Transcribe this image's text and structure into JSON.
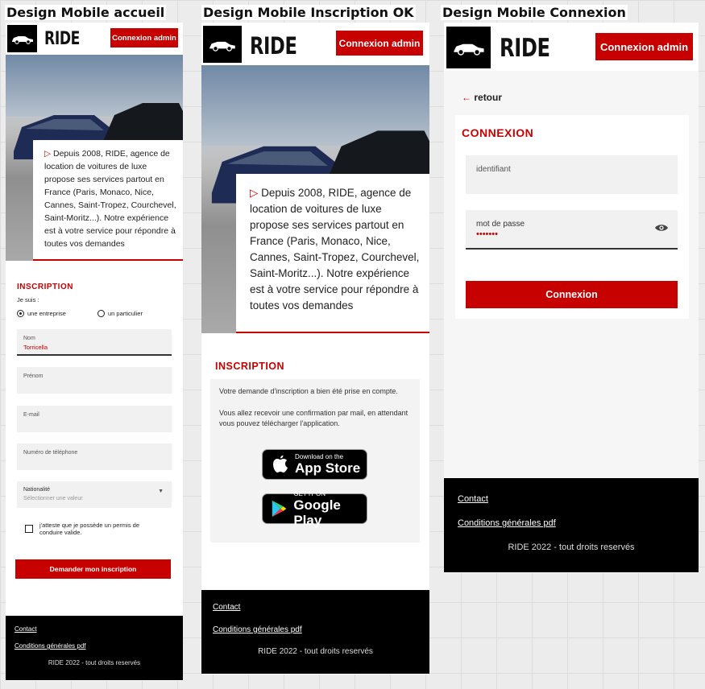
{
  "boards": {
    "home": "Design Mobile accueil",
    "signup_ok": "Design Mobile Inscription OK",
    "login": "Design Mobile Connexion"
  },
  "brand": {
    "name": "RIDE",
    "logo_icon": "car-icon"
  },
  "header": {
    "admin_button": "Connexion admin"
  },
  "hero": {
    "text": "Depuis 2008, RIDE, agence de location de voitures de luxe propose ses services partout en France (Paris, Monaco, Nice, Cannes, Saint-Tropez, Courchevel, Saint-Moritz...). Notre expérience est à votre service pour répondre à toutes vos demandes"
  },
  "signup_form": {
    "title": "INSCRIPTION",
    "iam_label": "Je suis :",
    "radio_company": "une entreprise",
    "radio_individual": "un particulier",
    "selected": "une entreprise",
    "name_label": "Nom",
    "name_value": "Torricella",
    "firstname_label": "Prénom",
    "email_label": "E-mail",
    "phone_label": "Numéro de téléphone",
    "nationality_label": "Nationalité",
    "nationality_placeholder": "Sélectionner une valeur",
    "license_checkbox": "j'atteste que je possède un permis de conduire valide.",
    "submit": "Demander mon inscription"
  },
  "signup_ok": {
    "title": "INSCRIPTION",
    "message_1": "Votre demande d'inscription a bien été prise en compte.",
    "message_2": "Vous allez recevoir une confirmation par mail, en attendant vous pouvez télécharger l'application.",
    "appstore_small": "Download on the",
    "appstore_big": "App Store",
    "googleplay_small": "GET IT ON",
    "googleplay_big": "Google Play"
  },
  "login": {
    "back": "retour",
    "title": "CONNEXION",
    "id_label": "identifiant",
    "pwd_label": "mot de passe",
    "pwd_value": "•••••••",
    "submit": "Connexion"
  },
  "footer": {
    "contact": "Contact",
    "terms": "Conditions générales pdf",
    "copyright": "RIDE 2022 - tout droits reservés"
  },
  "colors": {
    "accent": "#c70000",
    "dark": "#000000",
    "field": "#f1f1f1"
  }
}
